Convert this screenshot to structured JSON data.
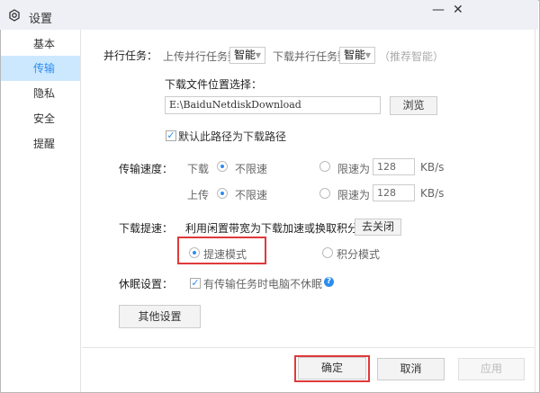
{
  "window": {
    "title": "设置",
    "minimize": "—",
    "close": "✕"
  },
  "sidebar": {
    "items": [
      {
        "label": "基本"
      },
      {
        "label": "传输",
        "selected": true
      },
      {
        "label": "隐私"
      },
      {
        "label": "安全"
      },
      {
        "label": "提醒"
      }
    ]
  },
  "parallel": {
    "label": "并行任务：",
    "upload_label": "上传并行任务数",
    "upload_value": "智能",
    "download_label": "下载并行任务数",
    "download_value": "智能",
    "hint": "（推荐智能）"
  },
  "location": {
    "label": "下载文件位置选择：",
    "path": "E:\\BaiduNetdiskDownload",
    "browse": "浏览",
    "default_check": "默认此路径为下载路径",
    "default_checked": true
  },
  "speed": {
    "label": "传输速度：",
    "download": "下载",
    "upload": "上传",
    "unlimited": "不限速",
    "limit": "限速为",
    "download_limit": "128",
    "upload_limit": "128",
    "unit": "KB/s"
  },
  "boost": {
    "label": "下载提速：",
    "desc": "利用闲置带宽为下载加速或换取积分",
    "close_btn": "去关闭",
    "mode_speed": "提速模式",
    "mode_points": "积分模式"
  },
  "sleep": {
    "label": "休眠设置：",
    "check": "有传输任务时电脑不休眠",
    "checked": true,
    "help": "?"
  },
  "other_btn": "其他设置",
  "footer": {
    "ok": "确定",
    "cancel": "取消",
    "apply": "应用"
  },
  "colors": {
    "accent": "#2d8cf0",
    "highlight": "#e0393b",
    "selected_bg": "#cce8ff"
  }
}
